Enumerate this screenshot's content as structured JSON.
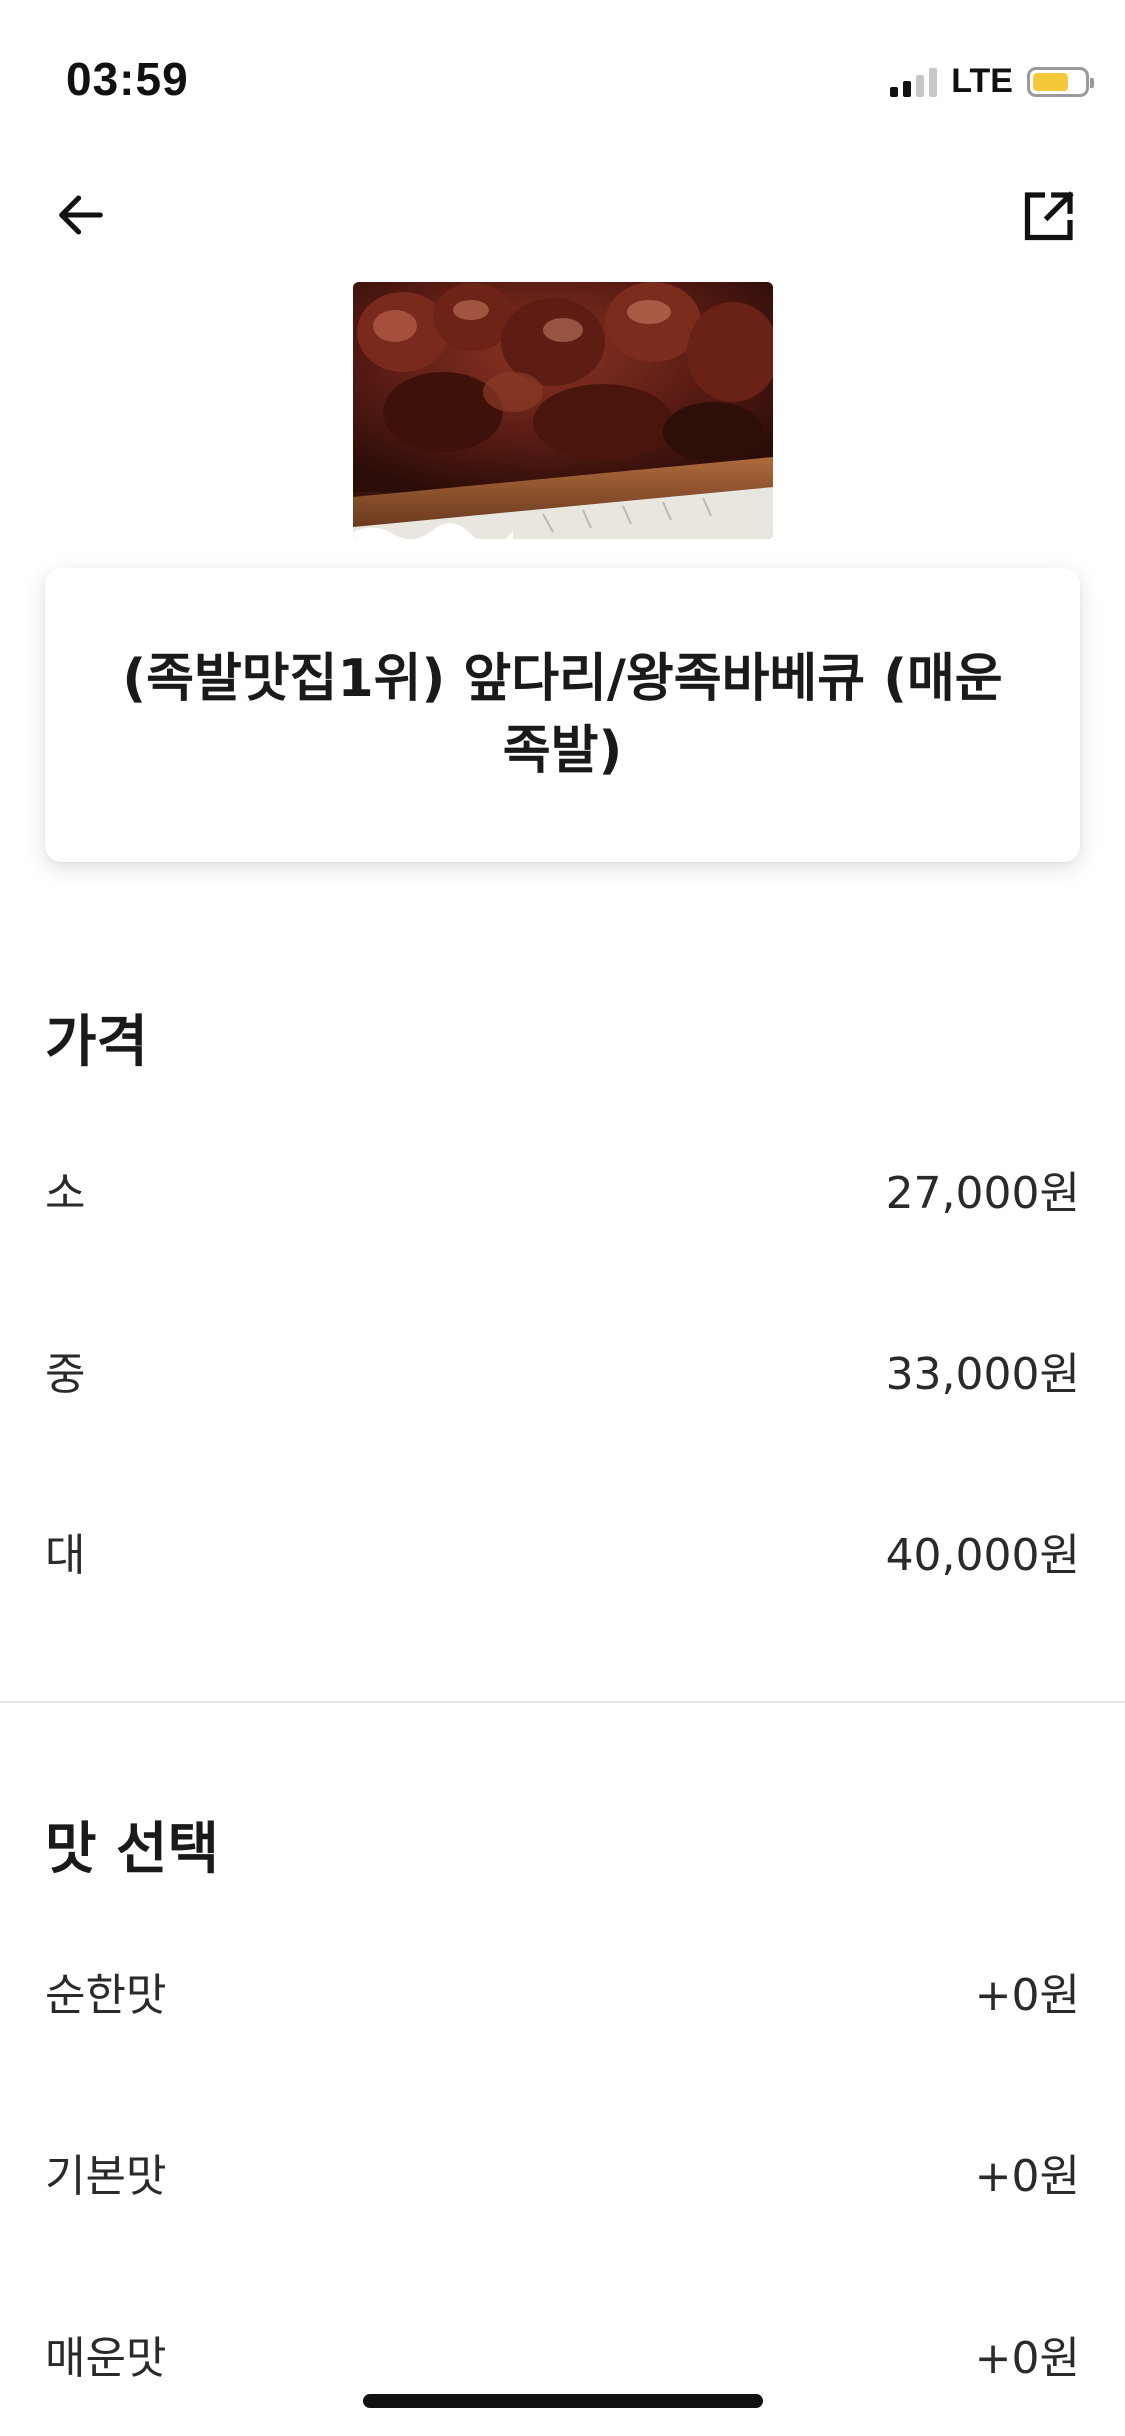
{
  "status_bar": {
    "time": "03:59",
    "network": "LTE",
    "signal_bars_active": 2,
    "signal_bars_total": 4,
    "battery_level": 0.7,
    "battery_color": "#f5c83a"
  },
  "nav": {
    "back_icon": "arrow-left-icon",
    "share_icon": "share-icon"
  },
  "menu": {
    "image_alt": "족발 사진",
    "title": "(족발맛집1위) 앞다리/왕족바베큐 (매운족발)"
  },
  "price_section": {
    "title": "가격",
    "options": [
      {
        "label": "소",
        "price": "27,000원"
      },
      {
        "label": "중",
        "price": "33,000원"
      },
      {
        "label": "대",
        "price": "40,000원"
      }
    ]
  },
  "flavor_section": {
    "title": "맛 선택",
    "options": [
      {
        "label": "순한맛",
        "price": "+0원"
      },
      {
        "label": "기본맛",
        "price": "+0원"
      },
      {
        "label": "매운맛",
        "price": "+0원"
      }
    ]
  }
}
